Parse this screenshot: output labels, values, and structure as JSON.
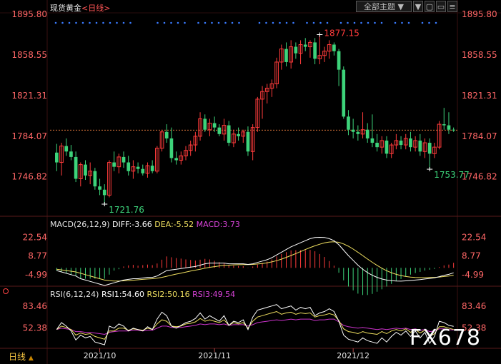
{
  "header": {
    "title": "现货黄金",
    "period_link": "<日线>",
    "theme_select": "全部主题",
    "theme_caret": "▼",
    "btn_down": "▼",
    "btn_restore": "▢",
    "btn_max": "▭",
    "btn_menu": "≡"
  },
  "footer": {
    "period_label": "日线",
    "period_caret": "▲",
    "watermark": "FX678"
  },
  "colors": {
    "up": "#ff3b3b",
    "down": "#3dd37a",
    "price_axis": "#ff6666",
    "white_line": "#ffffff",
    "yellow_line": "#f0e060",
    "magenta_line": "#cc33cc",
    "dot_blue": "#3a7bff",
    "guide": "#ff8844"
  },
  "chart_data": [
    {
      "type": "candlestick",
      "name": "main",
      "y_ticks": [
        "1895.80",
        "1858.55",
        "1821.31",
        "1784.07",
        "1746.82"
      ],
      "ylim": [
        1721.76,
        1895.8
      ],
      "x_ticks": [
        "2021/10",
        "2021/11",
        "2021/12"
      ],
      "current_price": 1789.6,
      "annotations": [
        {
          "label": "1877.15",
          "value": 1877.15,
          "index": 55
        },
        {
          "label": "1721.76",
          "value": 1721.76,
          "index": 10
        },
        {
          "label": "1753.77",
          "value": 1753.77,
          "index": 78
        }
      ],
      "candles": [
        {
          "o": 1769,
          "h": 1777,
          "l": 1752,
          "c": 1760
        },
        {
          "o": 1760,
          "h": 1778,
          "l": 1748,
          "c": 1775
        },
        {
          "o": 1775,
          "h": 1782,
          "l": 1766,
          "c": 1770
        },
        {
          "o": 1770,
          "h": 1776,
          "l": 1762,
          "c": 1765
        },
        {
          "o": 1765,
          "h": 1770,
          "l": 1742,
          "c": 1745
        },
        {
          "o": 1745,
          "h": 1760,
          "l": 1738,
          "c": 1758
        },
        {
          "o": 1758,
          "h": 1762,
          "l": 1744,
          "c": 1748
        },
        {
          "o": 1748,
          "h": 1760,
          "l": 1740,
          "c": 1752
        },
        {
          "o": 1752,
          "h": 1755,
          "l": 1735,
          "c": 1738
        },
        {
          "o": 1738,
          "h": 1745,
          "l": 1730,
          "c": 1735
        },
        {
          "o": 1735,
          "h": 1740,
          "l": 1721.76,
          "c": 1730
        },
        {
          "o": 1730,
          "h": 1762,
          "l": 1728,
          "c": 1760
        },
        {
          "o": 1760,
          "h": 1770,
          "l": 1752,
          "c": 1756
        },
        {
          "o": 1756,
          "h": 1768,
          "l": 1750,
          "c": 1765
        },
        {
          "o": 1765,
          "h": 1770,
          "l": 1755,
          "c": 1760
        },
        {
          "o": 1760,
          "h": 1766,
          "l": 1748,
          "c": 1752
        },
        {
          "o": 1752,
          "h": 1762,
          "l": 1745,
          "c": 1756
        },
        {
          "o": 1756,
          "h": 1760,
          "l": 1750,
          "c": 1754
        },
        {
          "o": 1754,
          "h": 1758,
          "l": 1748,
          "c": 1750
        },
        {
          "o": 1750,
          "h": 1760,
          "l": 1746,
          "c": 1757
        },
        {
          "o": 1757,
          "h": 1762,
          "l": 1750,
          "c": 1752
        },
        {
          "o": 1752,
          "h": 1775,
          "l": 1750,
          "c": 1773
        },
        {
          "o": 1773,
          "h": 1790,
          "l": 1770,
          "c": 1788
        },
        {
          "o": 1788,
          "h": 1795,
          "l": 1778,
          "c": 1782
        },
        {
          "o": 1782,
          "h": 1792,
          "l": 1760,
          "c": 1764
        },
        {
          "o": 1764,
          "h": 1770,
          "l": 1758,
          "c": 1762
        },
        {
          "o": 1762,
          "h": 1770,
          "l": 1758,
          "c": 1766
        },
        {
          "o": 1766,
          "h": 1775,
          "l": 1762,
          "c": 1771
        },
        {
          "o": 1771,
          "h": 1780,
          "l": 1766,
          "c": 1776
        },
        {
          "o": 1776,
          "h": 1788,
          "l": 1770,
          "c": 1784
        },
        {
          "o": 1784,
          "h": 1806,
          "l": 1780,
          "c": 1800
        },
        {
          "o": 1800,
          "h": 1804,
          "l": 1788,
          "c": 1790
        },
        {
          "o": 1790,
          "h": 1800,
          "l": 1784,
          "c": 1796
        },
        {
          "o": 1796,
          "h": 1802,
          "l": 1788,
          "c": 1792
        },
        {
          "o": 1792,
          "h": 1795,
          "l": 1784,
          "c": 1786
        },
        {
          "o": 1786,
          "h": 1800,
          "l": 1780,
          "c": 1794
        },
        {
          "o": 1794,
          "h": 1798,
          "l": 1775,
          "c": 1778
        },
        {
          "o": 1778,
          "h": 1790,
          "l": 1774,
          "c": 1786
        },
        {
          "o": 1786,
          "h": 1792,
          "l": 1780,
          "c": 1784
        },
        {
          "o": 1784,
          "h": 1790,
          "l": 1778,
          "c": 1788
        },
        {
          "o": 1788,
          "h": 1793,
          "l": 1766,
          "c": 1770
        },
        {
          "o": 1770,
          "h": 1795,
          "l": 1762,
          "c": 1792
        },
        {
          "o": 1792,
          "h": 1820,
          "l": 1788,
          "c": 1818
        },
        {
          "o": 1818,
          "h": 1830,
          "l": 1800,
          "c": 1825
        },
        {
          "o": 1825,
          "h": 1832,
          "l": 1814,
          "c": 1828
        },
        {
          "o": 1828,
          "h": 1836,
          "l": 1820,
          "c": 1832
        },
        {
          "o": 1832,
          "h": 1856,
          "l": 1828,
          "c": 1852
        },
        {
          "o": 1852,
          "h": 1868,
          "l": 1845,
          "c": 1864
        },
        {
          "o": 1864,
          "h": 1870,
          "l": 1848,
          "c": 1852
        },
        {
          "o": 1852,
          "h": 1872,
          "l": 1846,
          "c": 1866
        },
        {
          "o": 1866,
          "h": 1870,
          "l": 1855,
          "c": 1860
        },
        {
          "o": 1860,
          "h": 1872,
          "l": 1850,
          "c": 1868
        },
        {
          "o": 1868,
          "h": 1874,
          "l": 1862,
          "c": 1866
        },
        {
          "o": 1866,
          "h": 1872,
          "l": 1856,
          "c": 1870
        },
        {
          "o": 1870,
          "h": 1874,
          "l": 1850,
          "c": 1855
        },
        {
          "o": 1855,
          "h": 1877.15,
          "l": 1850,
          "c": 1858
        },
        {
          "o": 1858,
          "h": 1866,
          "l": 1852,
          "c": 1862
        },
        {
          "o": 1862,
          "h": 1872,
          "l": 1855,
          "c": 1868
        },
        {
          "o": 1868,
          "h": 1870,
          "l": 1858,
          "c": 1862
        },
        {
          "o": 1862,
          "h": 1864,
          "l": 1830,
          "c": 1845
        },
        {
          "o": 1845,
          "h": 1848,
          "l": 1800,
          "c": 1802
        },
        {
          "o": 1802,
          "h": 1808,
          "l": 1785,
          "c": 1790
        },
        {
          "o": 1790,
          "h": 1800,
          "l": 1782,
          "c": 1788
        },
        {
          "o": 1788,
          "h": 1794,
          "l": 1780,
          "c": 1786
        },
        {
          "o": 1786,
          "h": 1806,
          "l": 1782,
          "c": 1790
        },
        {
          "o": 1790,
          "h": 1796,
          "l": 1778,
          "c": 1782
        },
        {
          "o": 1782,
          "h": 1804,
          "l": 1774,
          "c": 1778
        },
        {
          "o": 1778,
          "h": 1786,
          "l": 1770,
          "c": 1774
        },
        {
          "o": 1774,
          "h": 1784,
          "l": 1768,
          "c": 1780
        },
        {
          "o": 1780,
          "h": 1784,
          "l": 1764,
          "c": 1768
        },
        {
          "o": 1768,
          "h": 1778,
          "l": 1764,
          "c": 1776
        },
        {
          "o": 1776,
          "h": 1786,
          "l": 1772,
          "c": 1780
        },
        {
          "o": 1780,
          "h": 1784,
          "l": 1772,
          "c": 1776
        },
        {
          "o": 1776,
          "h": 1786,
          "l": 1772,
          "c": 1782
        },
        {
          "o": 1782,
          "h": 1788,
          "l": 1770,
          "c": 1774
        },
        {
          "o": 1774,
          "h": 1784,
          "l": 1770,
          "c": 1780
        },
        {
          "o": 1780,
          "h": 1786,
          "l": 1766,
          "c": 1770
        },
        {
          "o": 1770,
          "h": 1782,
          "l": 1764,
          "c": 1778
        },
        {
          "o": 1778,
          "h": 1782,
          "l": 1753.77,
          "c": 1768
        },
        {
          "o": 1768,
          "h": 1778,
          "l": 1764,
          "c": 1774
        },
        {
          "o": 1774,
          "h": 1798,
          "l": 1772,
          "c": 1795
        },
        {
          "o": 1795,
          "h": 1810,
          "l": 1790,
          "c": 1794
        },
        {
          "o": 1794,
          "h": 1806,
          "l": 1786,
          "c": 1790
        },
        {
          "o": 1790,
          "h": 1792,
          "l": 1788,
          "c": 1789.6
        }
      ]
    },
    {
      "type": "line",
      "name": "MACD",
      "label": "MACD(26,12,9)",
      "diff_label": "DIFF:-3.66",
      "dea_label": "DEA:-5.52",
      "macd_label": "MACD:3.73",
      "y_ticks": [
        "22.54",
        "8.77",
        "-4.99"
      ],
      "ylim": [
        -13,
        28
      ],
      "diff": [
        -2,
        -3,
        -4,
        -5,
        -6,
        -8,
        -9,
        -10,
        -11,
        -12,
        -13,
        -12,
        -11,
        -10,
        -9,
        -8.5,
        -8,
        -8,
        -7.5,
        -7,
        -7,
        -6,
        -4,
        -2,
        -1.5,
        -1,
        -0.5,
        0,
        0.5,
        1,
        2,
        3,
        3.5,
        3.5,
        3.5,
        3.5,
        3,
        3,
        3,
        3,
        2.5,
        3,
        4,
        5,
        6,
        7.5,
        9.5,
        11.5,
        13.5,
        15.5,
        17,
        18.5,
        20,
        21.5,
        22.3,
        22.5,
        22.4,
        21.5,
        20,
        17,
        13,
        9,
        5.5,
        2,
        -1,
        -3.5,
        -5.5,
        -7,
        -8.2,
        -9,
        -9.5,
        -9.7,
        -9.8,
        -9.6,
        -9.3,
        -9,
        -8.7,
        -8.2,
        -7.8,
        -7.4,
        -6.5,
        -5.5,
        -4.8,
        -3.66
      ],
      "dea": [
        -1,
        -1.5,
        -2,
        -2.5,
        -3,
        -4,
        -5,
        -6,
        -7,
        -8,
        -9,
        -9.5,
        -9.7,
        -9.7,
        -9.6,
        -9.4,
        -9.1,
        -8.8,
        -8.5,
        -8.2,
        -8,
        -7.6,
        -7,
        -6.2,
        -5.4,
        -4.6,
        -3.9,
        -3.1,
        -2.4,
        -1.7,
        -1,
        -0.3,
        0.4,
        0.9,
        1.4,
        1.8,
        2,
        2.2,
        2.3,
        2.4,
        2.4,
        2.5,
        2.8,
        3.2,
        3.7,
        4.4,
        5.3,
        6.4,
        7.7,
        9.1,
        10.5,
        12,
        13.5,
        14.9,
        16.2,
        17.4,
        18.4,
        19,
        19.2,
        18.8,
        17.6,
        15.9,
        13.8,
        11.5,
        9,
        6.5,
        4.1,
        1.8,
        -0.3,
        -2.1,
        -3.6,
        -4.8,
        -5.7,
        -6.4,
        -6.8,
        -7.1,
        -7.2,
        -7.2,
        -7.1,
        -7,
        -6.8,
        -6.4,
        -6,
        -5.52
      ],
      "hist": [
        -2,
        -3,
        -4,
        -5,
        -6,
        -8,
        -8,
        -8,
        -8,
        -8,
        -8,
        -5,
        -2,
        -1,
        1,
        1.8,
        2.2,
        1.6,
        2,
        2.4,
        2,
        3.2,
        6,
        8.4,
        7.8,
        7.2,
        6.8,
        6.2,
        5.8,
        5.4,
        6,
        6.6,
        6.2,
        5.2,
        4.2,
        3.4,
        2,
        1.6,
        1.4,
        1.2,
        0.2,
        1,
        2.4,
        3.6,
        4.6,
        6.2,
        8.4,
        10.2,
        11.6,
        12.8,
        13,
        13,
        13,
        13.2,
        12.2,
        10.2,
        8,
        5,
        1.6,
        -3.6,
        -9.2,
        -13.8,
        -16.6,
        -19,
        -20,
        -20,
        -19.2,
        -17.6,
        -15.8,
        -13.8,
        -11.8,
        -9.8,
        -8.2,
        -6.4,
        -5,
        -3.8,
        -3,
        -2,
        -1.4,
        -0.8,
        0.6,
        1.8,
        2.4,
        3.73
      ]
    },
    {
      "type": "line",
      "name": "RSI",
      "label": "RSI(6,12,24)",
      "rsi1_label": "RSI1:54.60",
      "rsi2_label": "RSI2:50.16",
      "rsi3_label": "RSI3:49.54",
      "y_ticks": [
        "83.46",
        "52.38"
      ],
      "ylim": [
        25,
        95
      ],
      "rsi1": [
        50,
        60,
        55,
        48,
        35,
        42,
        38,
        40,
        32,
        30,
        28,
        55,
        52,
        58,
        55,
        48,
        52,
        50,
        48,
        54,
        50,
        65,
        75,
        70,
        55,
        52,
        56,
        60,
        62,
        66,
        74,
        65,
        70,
        66,
        62,
        70,
        56,
        62,
        60,
        64,
        50,
        68,
        78,
        80,
        82,
        84,
        86,
        80,
        82,
        84,
        78,
        82,
        80,
        82,
        70,
        74,
        76,
        80,
        76,
        62,
        42,
        36,
        34,
        32,
        38,
        34,
        32,
        30,
        38,
        32,
        40,
        46,
        42,
        48,
        40,
        48,
        38,
        46,
        30,
        40,
        62,
        60,
        56,
        54.6
      ],
      "rsi2": [
        50,
        55,
        53,
        50,
        42,
        45,
        43,
        44,
        40,
        38,
        36,
        48,
        48,
        52,
        52,
        49,
        51,
        50,
        49,
        52,
        50,
        58,
        64,
        62,
        55,
        54,
        55,
        58,
        59,
        61,
        66,
        62,
        64,
        62,
        60,
        64,
        56,
        60,
        58,
        60,
        52,
        62,
        68,
        70,
        72,
        74,
        76,
        72,
        74,
        75,
        72,
        74,
        73,
        74,
        68,
        70,
        71,
        73,
        71,
        63,
        51,
        47,
        46,
        44,
        47,
        45,
        44,
        43,
        47,
        44,
        48,
        50,
        48,
        51,
        46,
        50,
        45,
        49,
        40,
        44,
        54,
        54,
        52,
        50.16
      ],
      "rsi3": [
        50,
        52,
        51,
        50,
        47,
        47,
        46,
        46,
        45,
        44,
        43,
        46,
        47,
        48,
        48,
        48,
        49,
        49,
        48,
        49,
        49,
        52,
        55,
        55,
        53,
        53,
        53,
        54,
        55,
        56,
        58,
        57,
        58,
        58,
        57,
        58,
        56,
        57,
        57,
        57,
        55,
        57,
        60,
        61,
        62,
        63,
        64,
        63,
        64,
        65,
        64,
        65,
        65,
        65,
        63,
        64,
        64,
        65,
        65,
        61,
        56,
        54,
        53,
        52,
        53,
        52,
        51,
        50,
        51,
        50,
        51,
        52,
        51,
        52,
        50,
        51,
        49,
        50,
        47,
        48,
        51,
        51,
        50,
        49.54
      ]
    }
  ]
}
